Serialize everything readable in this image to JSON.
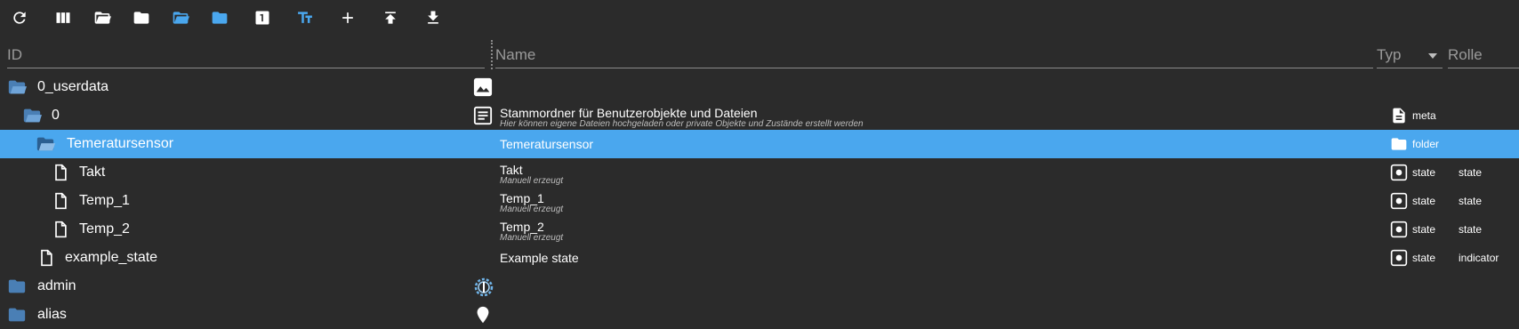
{
  "toolbar": {
    "icons": [
      "refresh-icon",
      "columns-icon",
      "folder-open-icon",
      "folder-closed-icon",
      "expand-all-icon",
      "collapse-all-icon",
      "numbered-view-icon",
      "text-size-icon",
      "add-icon",
      "upload-icon",
      "download-icon"
    ],
    "accent_color": "#4aa7ee"
  },
  "header": {
    "id_placeholder": "ID",
    "name_placeholder": "Name",
    "type_placeholder": "Typ",
    "role_placeholder": "Rolle"
  },
  "rows": [
    {
      "id": "0_userdata",
      "icon": "folder-open-icon",
      "objicon": "image-icon",
      "name": "",
      "desc": "",
      "type": "",
      "role": ""
    },
    {
      "id": "0",
      "icon": "folder-open-icon",
      "objicon": "document-icon",
      "name": "Stammordner für Benutzerobjekte und Dateien",
      "desc": "Hier können eigene Dateien hochgeladen oder private Objekte und Zustände erstellt werden",
      "type": "meta",
      "role": ""
    },
    {
      "id": "Temeratursensor",
      "icon": "folder-open-icon",
      "name": "Temeratursensor",
      "desc": "",
      "type": "folder",
      "role": "",
      "selected": true
    },
    {
      "id": "Takt",
      "icon": "file-icon",
      "name": "Takt",
      "desc": "Manuell erzeugt",
      "type": "state",
      "role": "state"
    },
    {
      "id": "Temp_1",
      "icon": "file-icon",
      "name": "Temp_1",
      "desc": "Manuell erzeugt",
      "type": "state",
      "role": "state"
    },
    {
      "id": "Temp_2",
      "icon": "file-icon",
      "name": "Temp_2",
      "desc": "Manuell erzeugt",
      "type": "state",
      "role": "state"
    },
    {
      "id": "example_state",
      "icon": "file-icon",
      "name": "Example state",
      "desc": "",
      "type": "state",
      "role": "indicator"
    },
    {
      "id": "admin",
      "icon": "folder-closed-icon",
      "objicon": "admin-gear-icon",
      "name": "",
      "desc": "",
      "type": "",
      "role": ""
    },
    {
      "id": "alias",
      "icon": "folder-closed-icon",
      "objicon": "alias-pin-icon",
      "name": "",
      "desc": "",
      "type": "",
      "role": ""
    }
  ]
}
